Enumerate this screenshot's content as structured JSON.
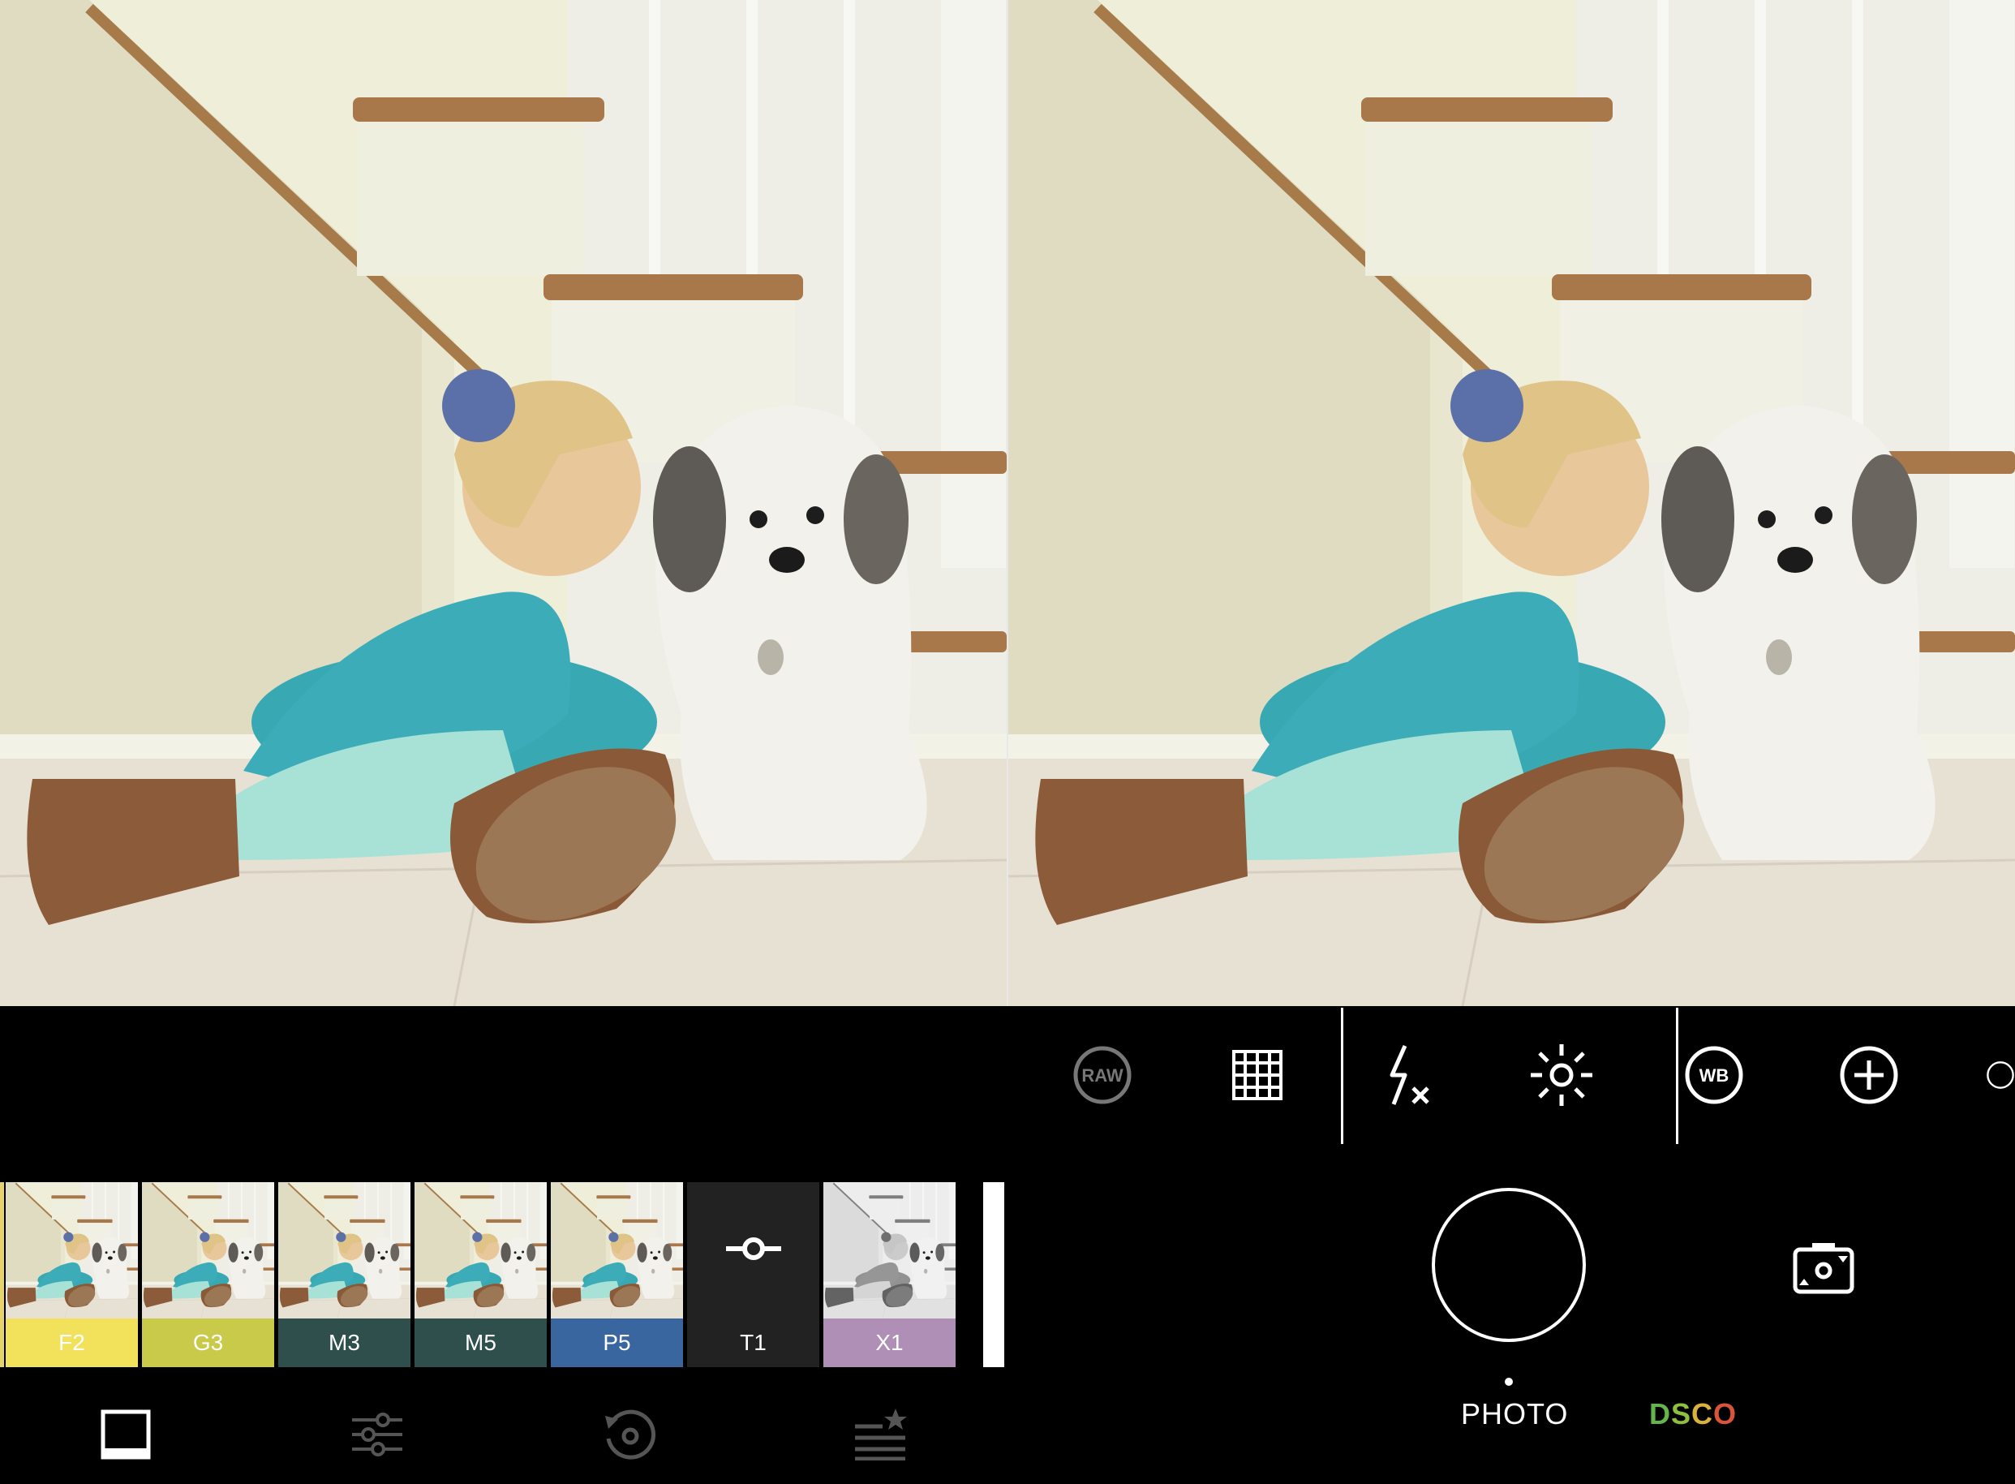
{
  "left_panel": {
    "filters": [
      {
        "label": "F2",
        "color": "#f2e15a"
      },
      {
        "label": "G3",
        "color": "#c9c94a"
      },
      {
        "label": "M3",
        "color": "#2e4f4b"
      },
      {
        "label": "M5",
        "color": "#2e4f4b"
      },
      {
        "label": "P5",
        "color": "#3a66a0"
      },
      {
        "label": "T1",
        "color": "#222222",
        "icon": "slider-tool-icon"
      },
      {
        "label": "X1",
        "color": "#b08fb6"
      }
    ],
    "bottom_nav": [
      {
        "name": "presets-tab",
        "icon": "square-frame-icon",
        "active": true
      },
      {
        "name": "adjust-tab",
        "icon": "sliders-icon",
        "active": false
      },
      {
        "name": "history-tab",
        "icon": "history-icon",
        "active": false
      },
      {
        "name": "favorites-tab",
        "icon": "star-list-icon",
        "active": false
      }
    ]
  },
  "right_panel": {
    "controls": [
      {
        "name": "raw-toggle",
        "label": "RAW",
        "icon": "raw-icon"
      },
      {
        "name": "grid-toggle",
        "icon": "grid-icon"
      },
      {
        "name": "flash-toggle",
        "icon": "flash-off-icon"
      },
      {
        "name": "exposure-toggle",
        "icon": "sun-icon"
      },
      {
        "name": "white-balance-toggle",
        "label": "WB",
        "icon": "wb-icon"
      },
      {
        "name": "exposure-comp-toggle",
        "icon": "plus-circle-icon"
      }
    ],
    "modes": {
      "photo": "PHOTO",
      "dsco": "DSCO"
    },
    "colors": {
      "accent_gradient": [
        "#6fc04e",
        "#e0b23a",
        "#d9553a"
      ]
    }
  }
}
